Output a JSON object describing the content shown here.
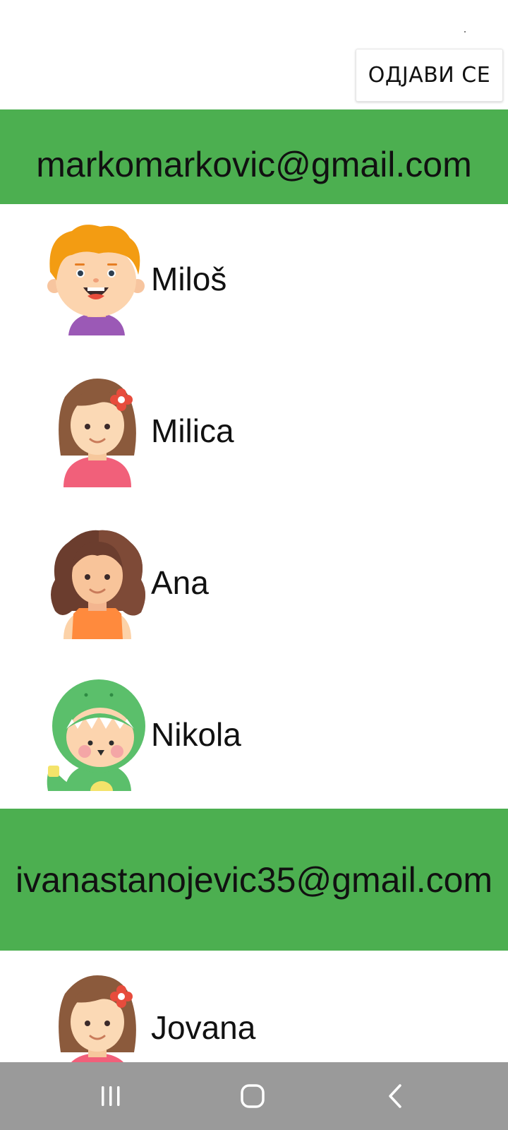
{
  "header": {
    "logout_label": "ОДЈАВИ СЕ"
  },
  "groups": [
    {
      "email": "markomarkovic@gmail.com",
      "children": [
        {
          "name": "Miloš",
          "avatar": "boy-avatar-icon"
        },
        {
          "name": "Milica",
          "avatar": "girl-flower-avatar-icon"
        },
        {
          "name": "Ana",
          "avatar": "girl-curly-avatar-icon"
        },
        {
          "name": "Nikola",
          "avatar": "dinosaur-costume-avatar-icon"
        }
      ]
    },
    {
      "email": "ivanastanojevic35@gmail.com",
      "children": [
        {
          "name": "Jovana",
          "avatar": "girl-flower-avatar-icon"
        }
      ]
    }
  ],
  "colors": {
    "group_header": "#4caf50",
    "navbar": "#9a9a9a"
  },
  "navbar": {
    "items": [
      "recent-apps-icon",
      "home-icon",
      "back-icon"
    ]
  }
}
